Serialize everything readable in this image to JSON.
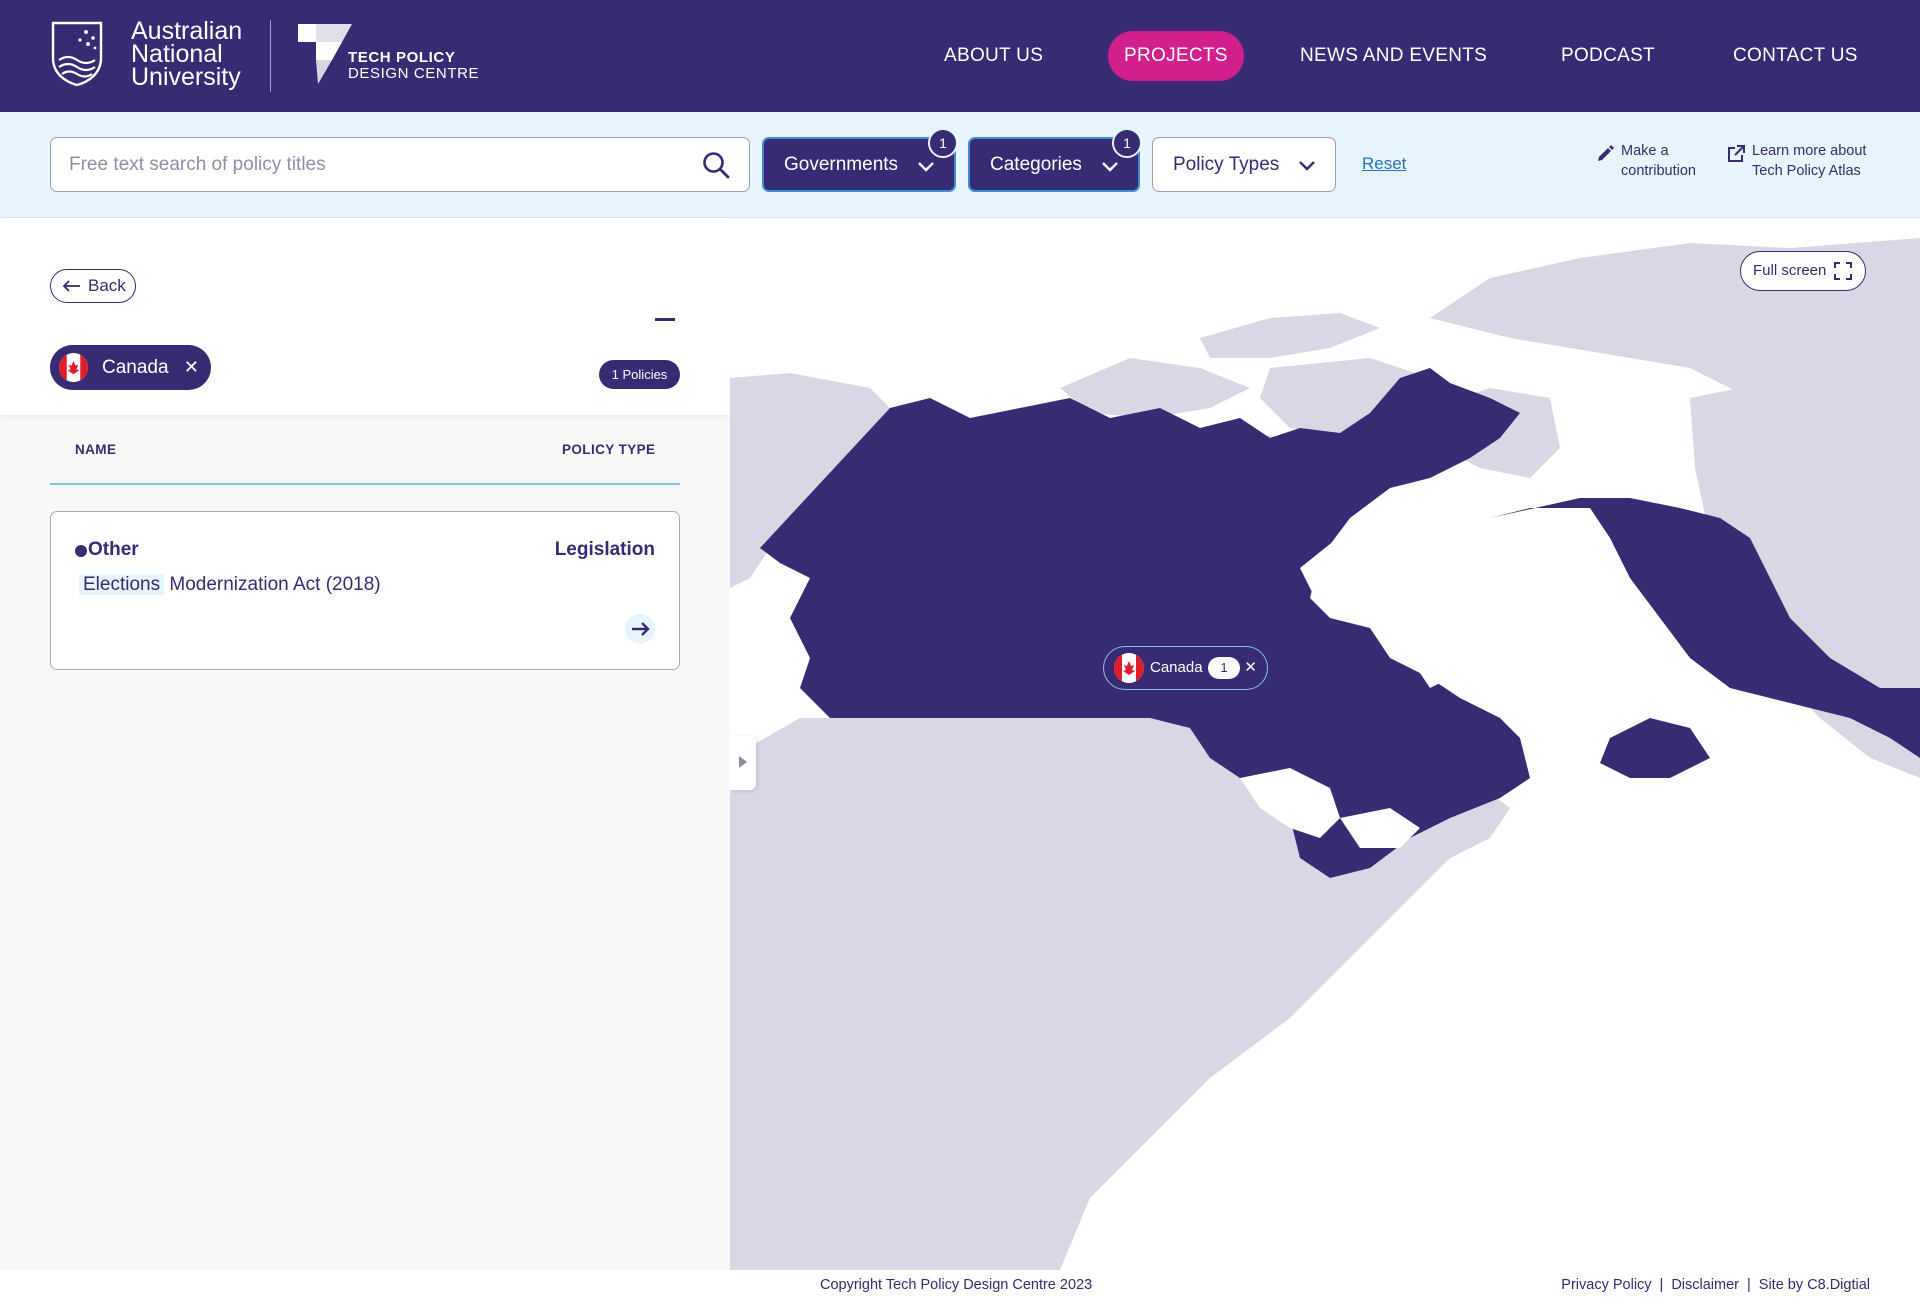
{
  "header": {
    "university_name": [
      "Australian",
      "National",
      "University"
    ],
    "centre_name_line1": "TECH POLICY",
    "centre_name_line2": "DESIGN CENTRE",
    "nav": [
      {
        "label": "ABOUT US",
        "active": false
      },
      {
        "label": "PROJECTS",
        "active": true
      },
      {
        "label": "NEWS AND EVENTS",
        "active": false
      },
      {
        "label": "PODCAST",
        "active": false
      },
      {
        "label": "CONTACT US",
        "active": false
      }
    ],
    "colors": {
      "header_bg": "#382b73",
      "active_nav": "#d11f8c"
    }
  },
  "filters": {
    "search_placeholder": "Free text search of policy titles",
    "search_value": "",
    "governments": {
      "label": "Governments",
      "count": "1"
    },
    "categories": {
      "label": "Categories",
      "count": "1"
    },
    "policy_types": {
      "label": "Policy Types"
    },
    "reset_label": "Reset",
    "make_contribution": [
      "Make a",
      "contribution"
    ],
    "learn_more": [
      "Learn more about",
      "Tech Policy Atlas"
    ]
  },
  "panel": {
    "back_label": "Back",
    "country": "Canada",
    "policies_count": "1 Policies",
    "columns": {
      "name": "NAME",
      "policy_type": "POLICY TYPE"
    },
    "policies": [
      {
        "category": "Other",
        "type": "Legislation",
        "title_highlight": "Elections",
        "title_rest": " Modernization Act (2018)"
      }
    ]
  },
  "map": {
    "fullscreen_label": "Full screen",
    "marker": {
      "country": "Canada",
      "count": "1"
    },
    "colors": {
      "selected": "#382b73",
      "land": "#d9d7e4",
      "water": "#ffffff"
    }
  },
  "footer": {
    "copyright": "Copyright Tech Policy Design Centre 2023",
    "links": [
      "Privacy Policy",
      "Disclaimer",
      "Site by C8.Digtial"
    ]
  }
}
